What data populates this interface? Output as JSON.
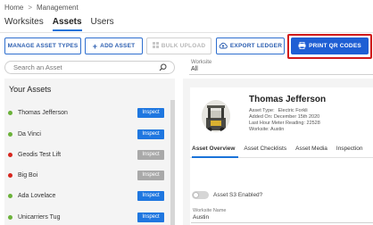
{
  "breadcrumb": {
    "home": "Home",
    "separator": ">",
    "current": "Management"
  },
  "tabs": [
    {
      "label": "Worksites"
    },
    {
      "label": "Assets"
    },
    {
      "label": "Users"
    }
  ],
  "toolbar": {
    "manage_label": "MANAGE ASSET TYPES",
    "add_label": "ADD ASSET",
    "bulk_label": "BULK UPLOAD",
    "export_label": "EXPORT LEDGER",
    "print_label": "PRINT QR CODES"
  },
  "search": {
    "placeholder": "Search an Asset"
  },
  "filter": {
    "label": "Worksite",
    "value": "All"
  },
  "assets": {
    "title": "Your Assets",
    "inspect_label": "Inspect",
    "items": [
      {
        "name": "Thomas Jefferson",
        "status_color": "#6bb23a",
        "inspect_color": "#1f77e0"
      },
      {
        "name": "Da Vinci",
        "status_color": "#6bb23a",
        "inspect_color": "#1f77e0"
      },
      {
        "name": "Geodis Test Lift",
        "status_color": "#d7261e",
        "inspect_color": "#a9a9a9"
      },
      {
        "name": "Big Boi",
        "status_color": "#d7261e",
        "inspect_color": "#a9a9a9"
      },
      {
        "name": "Ada Lovelace",
        "status_color": "#6bb23a",
        "inspect_color": "#1f77e0"
      },
      {
        "name": "Unicarriers Tug",
        "status_color": "#6bb23a",
        "inspect_color": "#1f77e0"
      }
    ]
  },
  "detail": {
    "name": "Thomas Jefferson",
    "asset_type_label": "Asset Type:",
    "asset_type_value": "Electric Forkli",
    "added_on": "Added On: December 15th 2020",
    "last_hour_meter": "Last Hour Meter Reading: 22528",
    "worksite": "Worksite: Austin",
    "tabs": [
      "Asset Overview",
      "Asset Checklists",
      "Asset Media",
      "Inspection"
    ],
    "s3_label": "Asset S3 Enabled?",
    "worksite_name_label": "Worksite Name",
    "worksite_name_value": "Austin"
  },
  "colors": {
    "accent": "#1f5fd4",
    "highlight": "#d11a1a",
    "ok": "#6bb23a",
    "fault": "#d7261e"
  }
}
